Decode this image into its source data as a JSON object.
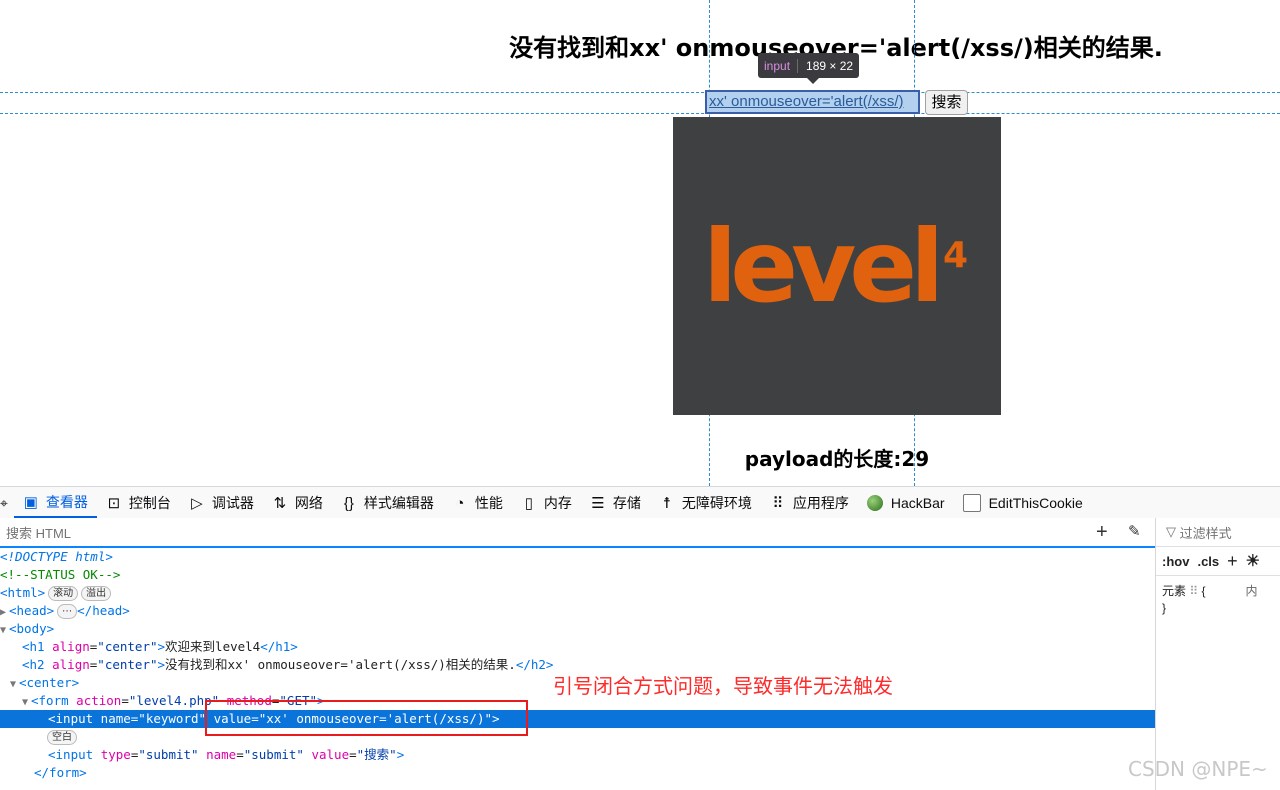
{
  "page": {
    "heading": "没有找到和xx' onmouseover='alert(/xss/)相关的结果.",
    "tooltip_tag": "input",
    "tooltip_dims": "189 × 22",
    "search_value": "xx' onmouseover='alert(/xss/)",
    "search_button": "搜索",
    "image_text": "level",
    "image_superscript": "4",
    "payload_length": "payload的长度:29"
  },
  "devtools": {
    "tabs": [
      {
        "label": "查看器",
        "icon": "inspector-icon",
        "active": true
      },
      {
        "label": "控制台",
        "icon": "console-icon"
      },
      {
        "label": "调试器",
        "icon": "debugger-icon"
      },
      {
        "label": "网络",
        "icon": "network-icon"
      },
      {
        "label": "样式编辑器",
        "icon": "style-editor-icon"
      },
      {
        "label": "性能",
        "icon": "performance-icon"
      },
      {
        "label": "内存",
        "icon": "memory-icon"
      },
      {
        "label": "存储",
        "icon": "storage-icon"
      },
      {
        "label": "无障碍环境",
        "icon": "accessibility-icon"
      },
      {
        "label": "应用程序",
        "icon": "application-icon"
      },
      {
        "label": "HackBar",
        "icon": "hackbar-icon"
      },
      {
        "label": "EditThisCookie",
        "icon": "cookie-icon"
      }
    ],
    "search_placeholder": "搜索 HTML",
    "badges": {
      "scroll": "滚动",
      "overflow": "溢出",
      "ellipsis": "⋯",
      "whitespace": "空白"
    },
    "tree": {
      "doctype": "<!DOCTYPE html>",
      "comment": "<!--STATUS OK-->",
      "html_open": "<html>",
      "head_open": "<head>",
      "head_close": "</head>",
      "body_open": "<body>",
      "h1_tag": "h1",
      "h1_attr": "align",
      "h1_val": "\"center\"",
      "h1_text": "欢迎来到level4",
      "h1_close": "</h1>",
      "h2_tag": "h2",
      "h2_attr": "align",
      "h2_val": "\"center\"",
      "h2_text": "没有找到和xx' onmouseover='alert(/xss/)相关的结果.",
      "h2_close": "</h2>",
      "center_open": "<center>",
      "form_tag": "form",
      "form_attr1": "action",
      "form_val1": "\"level4.php\"",
      "form_attr2": "method",
      "form_val2": "\"GET\"",
      "input_line": "<input name=\"keyword\" value=\"xx' onmouseover='alert(/xss/)\">",
      "submit_tag": "input",
      "submit_attr1": "type",
      "submit_val1": "\"submit\"",
      "submit_attr2": "name",
      "submit_val2": "\"submit\"",
      "submit_attr3": "value",
      "submit_val3": "\"搜索\"",
      "form_close": "</form>"
    },
    "annotation": "引号闭合方式问题，导致事件无法触发",
    "rules": {
      "filter_placeholder": "过滤样式",
      "hov": ":hov",
      "cls": ".cls",
      "element_label": "元素",
      "brace_open": "{",
      "inline_label": "内",
      "brace_close": "}"
    }
  },
  "watermark": "CSDN @NPE~"
}
